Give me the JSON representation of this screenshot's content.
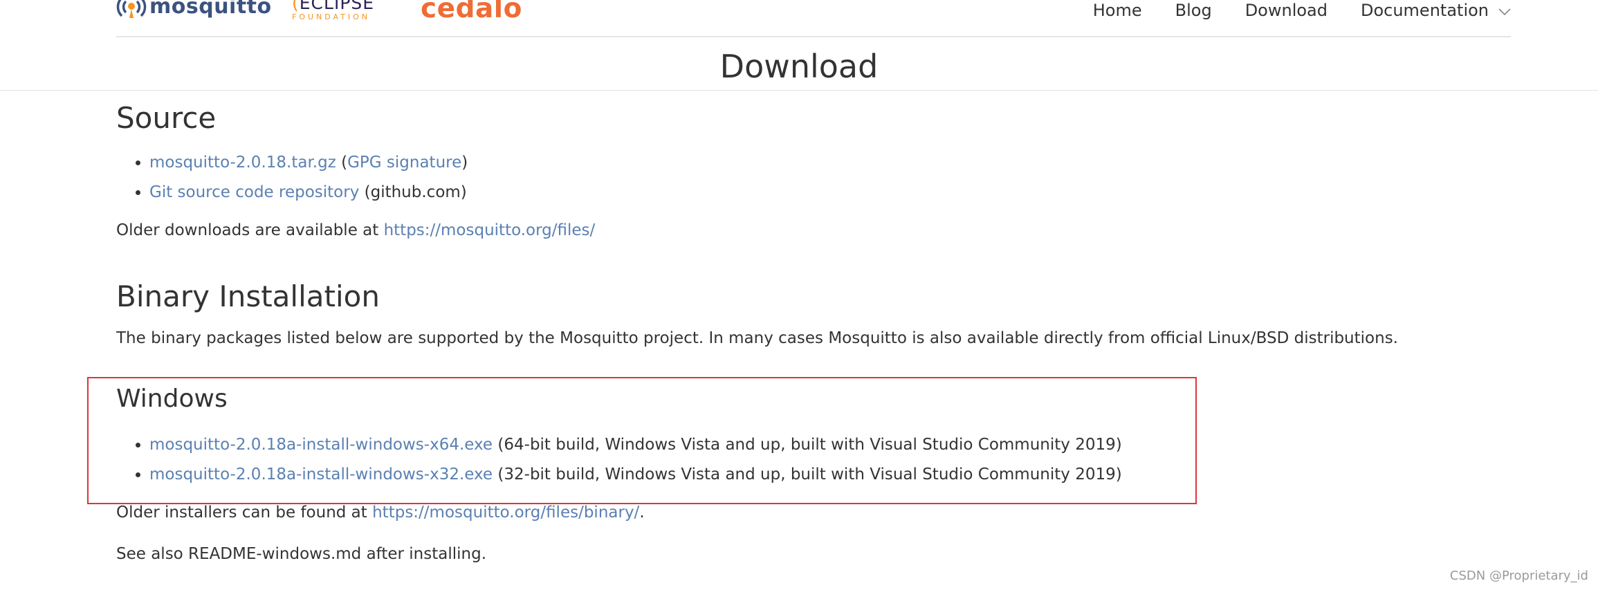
{
  "brand": {
    "mosquitto": "mosquitto",
    "eclipse_main": "ECLIPSE",
    "eclipse_sub": "FOUNDATION",
    "cedalo": "cedalo",
    "colors": {
      "mosquitto": "#3c5280",
      "eclipse_orange": "#f7941e",
      "cedalo": "#ef6c35"
    }
  },
  "nav": {
    "links": [
      "Home",
      "Blog",
      "Download",
      "Documentation"
    ],
    "dropdown_icon": "chevron-down-icon"
  },
  "page_title": "Download",
  "source": {
    "heading": "Source",
    "items": [
      {
        "link": "mosquitto-2.0.18.tar.gz",
        "pre": " (",
        "link2": "GPG signature",
        "post": ")"
      },
      {
        "link": "Git source code repository",
        "post": " (github.com)"
      }
    ],
    "older_prefix": "Older downloads are available at ",
    "older_link": "https://mosquitto.org/files/"
  },
  "binary": {
    "heading": "Binary Installation",
    "description": "The binary packages listed below are supported by the Mosquitto project. In many cases Mosquitto is also available directly from official Linux/BSD distributions."
  },
  "windows": {
    "heading": "Windows",
    "items": [
      {
        "link": "mosquitto-2.0.18a-install-windows-x64.exe",
        "note": " (64-bit build, Windows Vista and up, built with Visual Studio Community 2019)"
      },
      {
        "link": "mosquitto-2.0.18a-install-windows-x32.exe",
        "note": " (32-bit build, Windows Vista and up, built with Visual Studio Community 2019)"
      }
    ],
    "older_prefix": "Older installers can be found at ",
    "older_link": "https://mosquitto.org/files/binary/",
    "older_suffix": ".",
    "see_also": "See also README-windows.md after installing."
  },
  "watermark": "CSDN @Proprietary_id",
  "colors": {
    "link": "#5b80b2",
    "text": "#333333",
    "highlight_border": "#d9363e"
  }
}
